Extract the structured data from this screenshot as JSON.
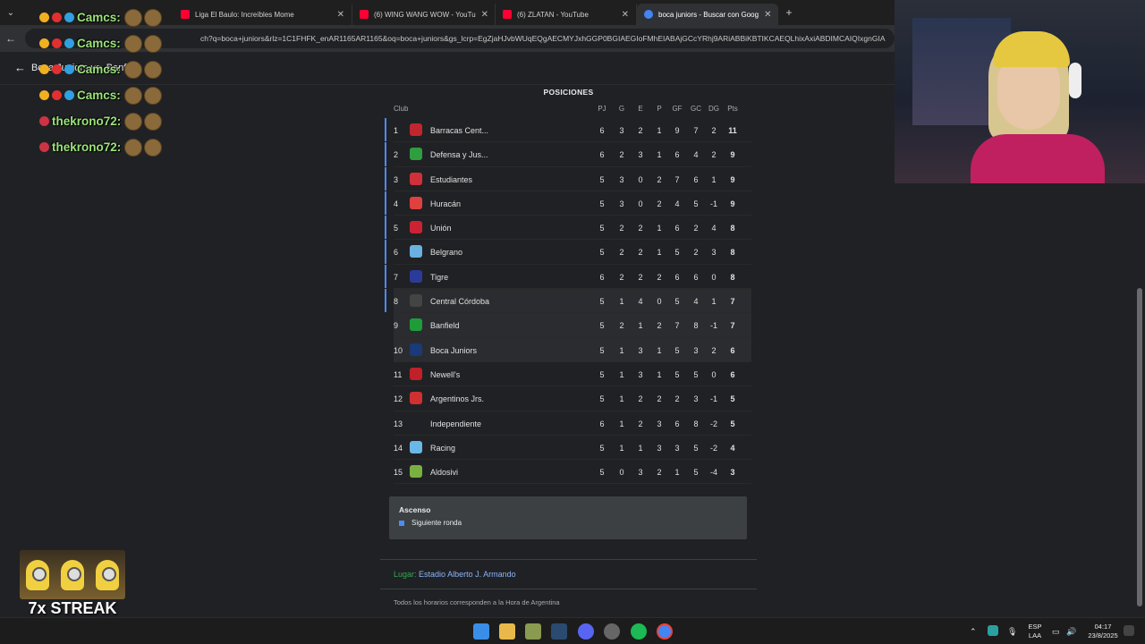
{
  "browser": {
    "tabs": [
      {
        "label": "Liga El Baulo: Increíbles Mome",
        "favicon_color": "#ff0033",
        "active": false
      },
      {
        "label": "(6) WING WANG WOW - YouTu",
        "favicon_color": "#ff0033",
        "active": false
      },
      {
        "label": "(6) ZLATAN - YouTube",
        "favicon_color": "#ff0033",
        "active": false
      },
      {
        "label": "boca juniors - Buscar con Goog",
        "favicon_color": "#4285f4",
        "active": true
      }
    ],
    "new_tab_symbol": "+",
    "url": "ch?q=boca+juniors&rlz=1C1FHFK_enAR1165AR1165&oq=boca+juniors&gs_lcrp=EgZjaHJvbWUqEQgAECMYJxhGGP0BGIAEGIoFMhEIABAjGCcYRhj9ARiABBiKBTIKCAEQLhixAxiABDIMCAIQIxgnGIA"
  },
  "page": {
    "match_title": "Boca Juniors vs. Banfie"
  },
  "standings": {
    "title": "POSICIONES",
    "headers": {
      "club": "Club",
      "pj": "PJ",
      "g": "G",
      "e": "E",
      "p": "P",
      "gf": "GF",
      "gc": "GC",
      "dg": "DG",
      "pts": "Pts"
    },
    "rows": [
      {
        "rank": "1",
        "club": "Barracas Cent...",
        "pj": "6",
        "g": "3",
        "e": "2",
        "p": "1",
        "gf": "9",
        "gc": "7",
        "dg": "2",
        "pts": "11",
        "color": "#c0262d",
        "promo": true
      },
      {
        "rank": "2",
        "club": "Defensa y Jus...",
        "pj": "6",
        "g": "2",
        "e": "3",
        "p": "1",
        "gf": "6",
        "gc": "4",
        "dg": "2",
        "pts": "9",
        "color": "#2e9e3e",
        "promo": true
      },
      {
        "rank": "3",
        "club": "Estudiantes",
        "pj": "5",
        "g": "3",
        "e": "0",
        "p": "2",
        "gf": "7",
        "gc": "6",
        "dg": "1",
        "pts": "9",
        "color": "#d0303a",
        "promo": true
      },
      {
        "rank": "4",
        "club": "Huracán",
        "pj": "5",
        "g": "3",
        "e": "0",
        "p": "2",
        "gf": "4",
        "gc": "5",
        "dg": "-1",
        "pts": "9",
        "color": "#e04040",
        "promo": true
      },
      {
        "rank": "5",
        "club": "Unión",
        "pj": "5",
        "g": "2",
        "e": "2",
        "p": "1",
        "gf": "6",
        "gc": "2",
        "dg": "4",
        "pts": "8",
        "color": "#cc2233",
        "promo": true
      },
      {
        "rank": "6",
        "club": "Belgrano",
        "pj": "5",
        "g": "2",
        "e": "2",
        "p": "1",
        "gf": "5",
        "gc": "2",
        "dg": "3",
        "pts": "8",
        "color": "#6ab0e0",
        "promo": true
      },
      {
        "rank": "7",
        "club": "Tigre",
        "pj": "6",
        "g": "2",
        "e": "2",
        "p": "2",
        "gf": "6",
        "gc": "6",
        "dg": "0",
        "pts": "8",
        "color": "#2c3a9a",
        "promo": true
      },
      {
        "rank": "8",
        "club": "Central Córdoba",
        "pj": "5",
        "g": "1",
        "e": "4",
        "p": "0",
        "gf": "5",
        "gc": "4",
        "dg": "1",
        "pts": "7",
        "color": "#444444",
        "promo": true,
        "highlight": true
      },
      {
        "rank": "9",
        "club": "Banfield",
        "pj": "5",
        "g": "2",
        "e": "1",
        "p": "2",
        "gf": "7",
        "gc": "8",
        "dg": "-1",
        "pts": "7",
        "color": "#1f9c3a",
        "promo": false,
        "highlight": true
      },
      {
        "rank": "10",
        "club": "Boca Juniors",
        "pj": "5",
        "g": "1",
        "e": "3",
        "p": "1",
        "gf": "5",
        "gc": "3",
        "dg": "2",
        "pts": "6",
        "color": "#1a3a7a",
        "promo": false,
        "highlight": true
      },
      {
        "rank": "11",
        "club": "Newell's",
        "pj": "5",
        "g": "1",
        "e": "3",
        "p": "1",
        "gf": "5",
        "gc": "5",
        "dg": "0",
        "pts": "6",
        "color": "#c0202a",
        "promo": false
      },
      {
        "rank": "12",
        "club": "Argentinos Jrs.",
        "pj": "5",
        "g": "1",
        "e": "2",
        "p": "2",
        "gf": "2",
        "gc": "3",
        "dg": "-1",
        "pts": "5",
        "color": "#d03030",
        "promo": false
      },
      {
        "rank": "13",
        "club": "Independiente",
        "pj": "6",
        "g": "1",
        "e": "2",
        "p": "3",
        "gf": "6",
        "gc": "8",
        "dg": "-2",
        "pts": "5",
        "color": "#202028",
        "promo": false
      },
      {
        "rank": "14",
        "club": "Racing",
        "pj": "5",
        "g": "1",
        "e": "1",
        "p": "3",
        "gf": "3",
        "gc": "5",
        "dg": "-2",
        "pts": "4",
        "color": "#6ab8e8",
        "promo": false
      },
      {
        "rank": "15",
        "club": "Aldosivi",
        "pj": "5",
        "g": "0",
        "e": "3",
        "p": "2",
        "gf": "1",
        "gc": "5",
        "dg": "-4",
        "pts": "3",
        "color": "#7ab040",
        "promo": false
      }
    ],
    "legend": {
      "title": "Ascenso",
      "item": "Siguiente ronda",
      "color": "#4c8bf5"
    },
    "venue_label": "Lugar:",
    "venue": "Estadio Alberto J. Armando",
    "timezone_note": "Todos los horarios corresponden a la Hora de Argentina"
  },
  "chat": {
    "lines": [
      {
        "name": "Camcs:",
        "emotes": 2
      },
      {
        "name": "Camcs:",
        "emotes": 2
      },
      {
        "name": "Camcs:",
        "emotes": 2
      },
      {
        "name": "Camcs:",
        "emotes": 2
      },
      {
        "name": "thekrono72:",
        "emotes": 2
      },
      {
        "name": "thekrono72:",
        "emotes": 2
      }
    ]
  },
  "overlay": {
    "streak_text": "7x STREAK"
  },
  "taskbar": {
    "language": "ESP",
    "layout": "LAA",
    "time": "04:17",
    "date": "23/8/2025"
  }
}
